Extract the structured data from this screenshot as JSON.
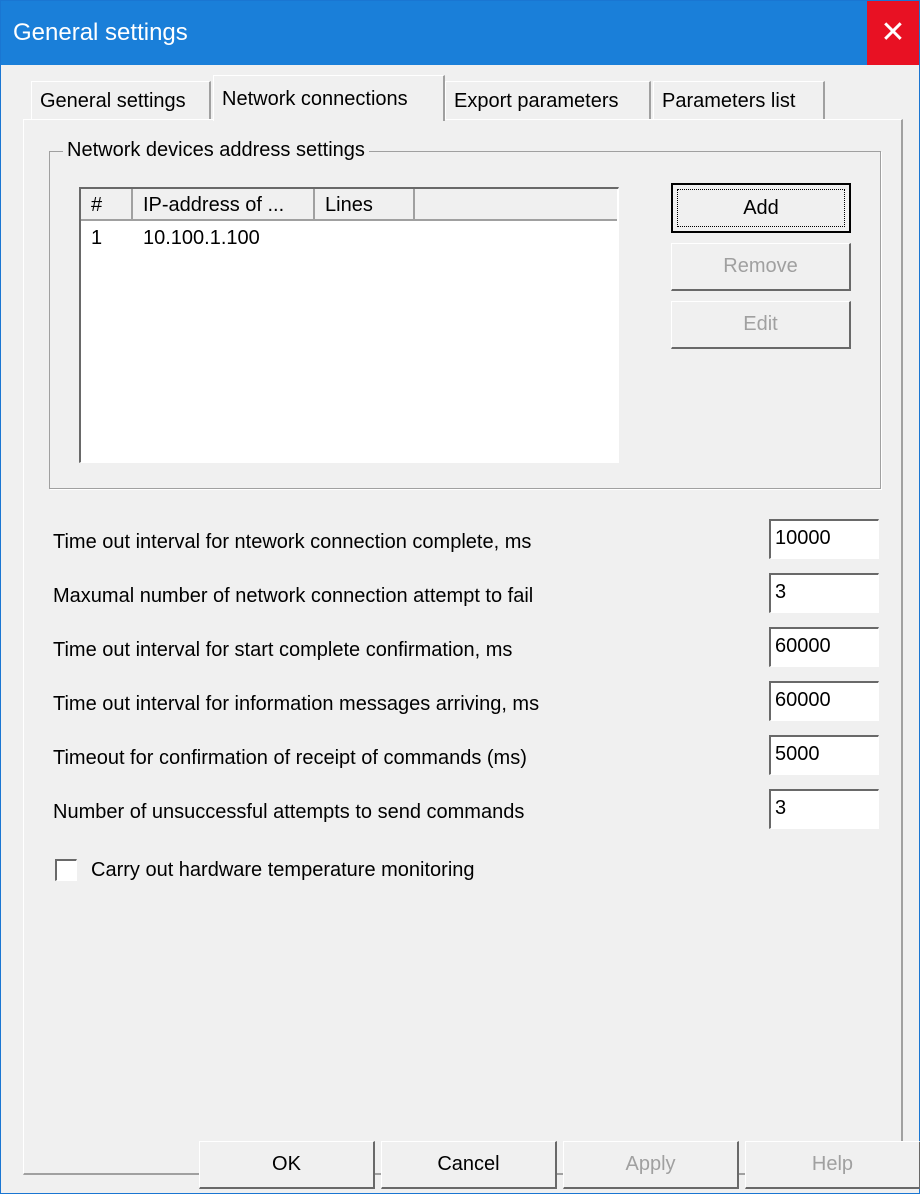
{
  "window": {
    "title": "General settings",
    "close_glyph": "✕"
  },
  "tabs": [
    {
      "label": "General settings",
      "active": false
    },
    {
      "label": "Network connections",
      "active": true
    },
    {
      "label": "Export parameters",
      "active": false
    },
    {
      "label": "Parameters list",
      "active": false
    }
  ],
  "network_group": {
    "title": "Network devices address settings",
    "columns": [
      "#",
      "IP-address of ...",
      "Lines",
      ""
    ],
    "rows": [
      {
        "num": "1",
        "ip": "10.100.1.100",
        "lines": ""
      }
    ],
    "buttons": {
      "add": "Add",
      "remove": "Remove",
      "edit": "Edit"
    }
  },
  "settings": [
    {
      "label": "Time out interval for ntework connection complete, ms",
      "value": "10000"
    },
    {
      "label": "Maxumal number of network connection attempt to fail",
      "value": "3"
    },
    {
      "label": "Time out interval for start complete confirmation, ms",
      "value": "60000"
    },
    {
      "label": "Time out interval for information messages arriving, ms",
      "value": "60000"
    },
    {
      "label": "Timeout for confirmation of receipt of commands (ms)",
      "value": "5000"
    },
    {
      "label": "Number of unsuccessful attempts to send commands",
      "value": "3"
    }
  ],
  "checkbox": {
    "label": "Carry out hardware temperature monitoring",
    "checked": false
  },
  "dialog_buttons": {
    "ok": "OK",
    "cancel": "Cancel",
    "apply": "Apply",
    "help": "Help"
  },
  "colors": {
    "titlebar": "#1a7fd9",
    "close": "#e81123",
    "background": "#f0f0f0"
  }
}
